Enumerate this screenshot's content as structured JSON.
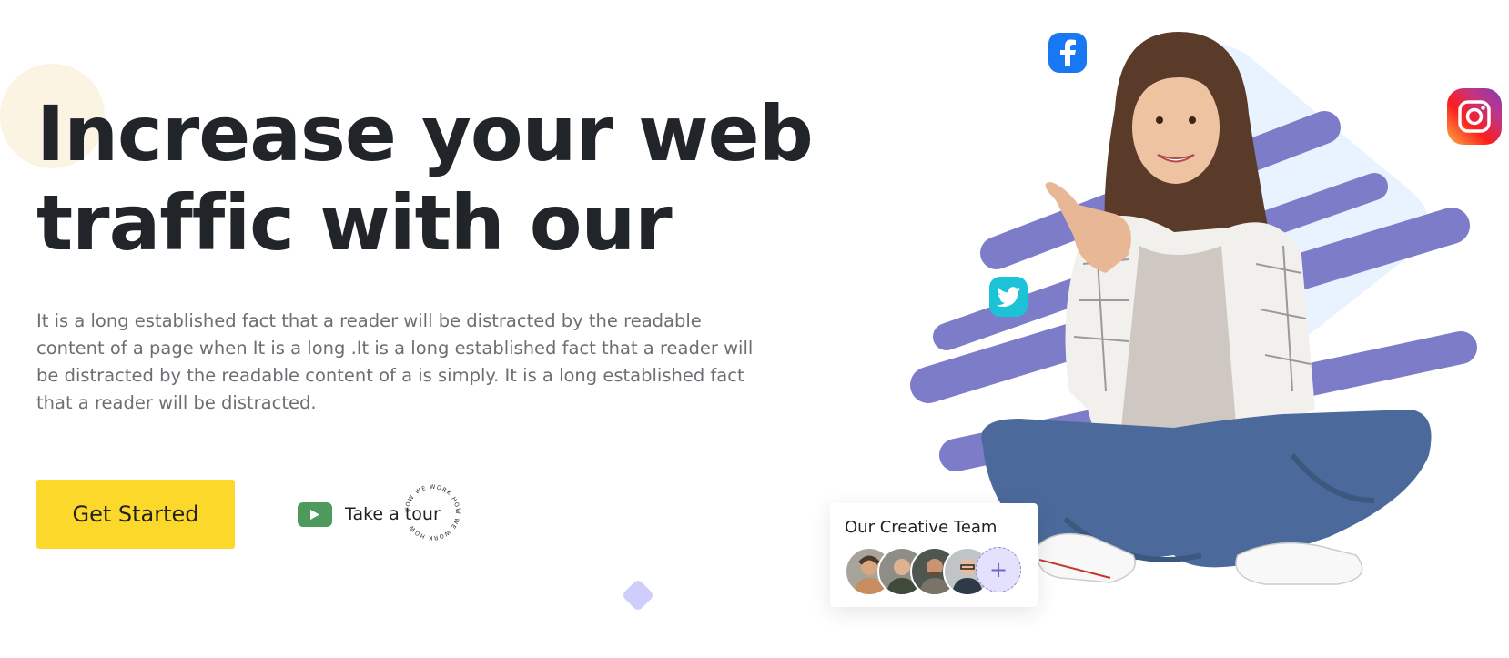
{
  "hero": {
    "headline_line1": "Increase your web",
    "headline_line2": "traffic with our",
    "description": "It is a long established fact that a reader will be distracted by the readable content of a page when It is a long .It is a long established fact that a reader will be distracted by the readable content of a is simply. It is a long established fact that a reader will be distracted.",
    "cta_label": "Get Started",
    "tour_label": "Take a tour",
    "ring_text": "HOW WE WORK HOW WE WORK HOW "
  },
  "team_card": {
    "title": "Our Creative Team",
    "add_symbol": "+"
  },
  "social_icons": [
    "facebook-icon",
    "twitter-icon",
    "instagram-icon"
  ],
  "colors": {
    "heading": "#212529",
    "body_text": "#6b6f73",
    "cta_background": "#fbd829",
    "play_button": "#4e9a5c",
    "accent_purple": "#7c7cc9",
    "accent_light_blue": "#e8f3ff",
    "deco_beige": "#fbf4e3"
  }
}
